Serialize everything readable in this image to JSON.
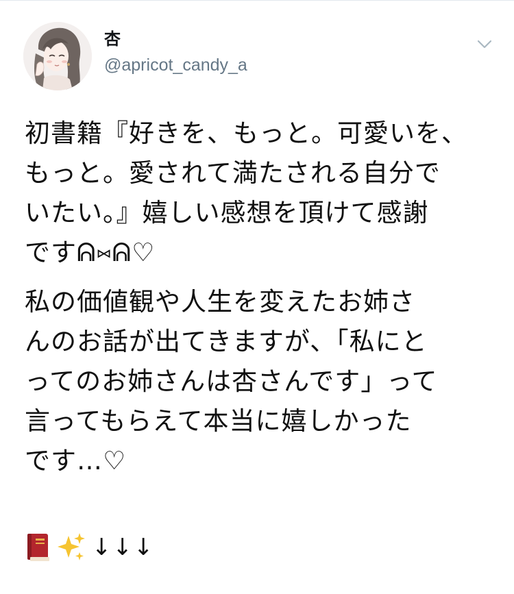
{
  "tweet": {
    "author": {
      "display_name": "杏",
      "handle": "@apricot_candy_a",
      "avatar_icon": "illustrated-woman-avatar"
    },
    "menu_icon": "chevron-down-icon",
    "paragraphs": [
      "初書籍『好きを、もっと。可愛いを、\nもっと。愛されて満たされる自分で\nいたい。』嬉しい感想を頂けて感謝\nですᕱ⑅ᕱ♡",
      "私の価値観や人生を変えたお姉さ\nんのお話が出てきますが、「私にと\nってのお姉さんは杏さんです」って\n言ってもらえて本当に嬉しかった\nです…♡"
    ],
    "emoji_line": {
      "icons": [
        "book-emoji",
        "sparkles-emoji"
      ],
      "arrows": "↓↓↓"
    }
  },
  "colors": {
    "name": "#14171a",
    "handle": "#657786",
    "text": "#111111",
    "divider": "#e1e8ed",
    "chevron": "#aab8c2",
    "book": "#b3262d",
    "sparkles": "#f6c431"
  }
}
